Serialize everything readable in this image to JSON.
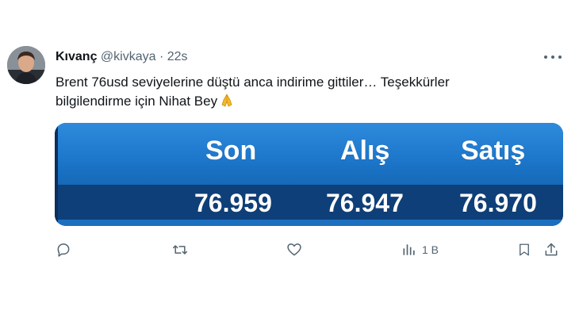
{
  "tweet": {
    "author_name": "Kıvanç",
    "handle": "@kivkaya",
    "separator": "·",
    "time": "22s",
    "text_line1": "Brent 76usd seviyelerine düştü anca indirime gittiler… Teşekkürler",
    "text_line2": "bilgilendirme için Nihat Bey",
    "emoji": "🙏"
  },
  "media": {
    "headers": [
      "Son",
      "Alış",
      "Satış"
    ],
    "values": [
      "76.959",
      "76.947",
      "76.970"
    ],
    "colors": {
      "header_bg": "#1e78cc",
      "value_band": "#0e3f79",
      "text": "#ffffff"
    }
  },
  "actions": {
    "views_count": "1 B",
    "icons": [
      "reply-icon",
      "retweet-icon",
      "like-icon",
      "views-icon",
      "bookmark-icon",
      "share-icon"
    ]
  },
  "colors": {
    "text_primary": "#0f1419",
    "text_secondary": "#536471"
  }
}
